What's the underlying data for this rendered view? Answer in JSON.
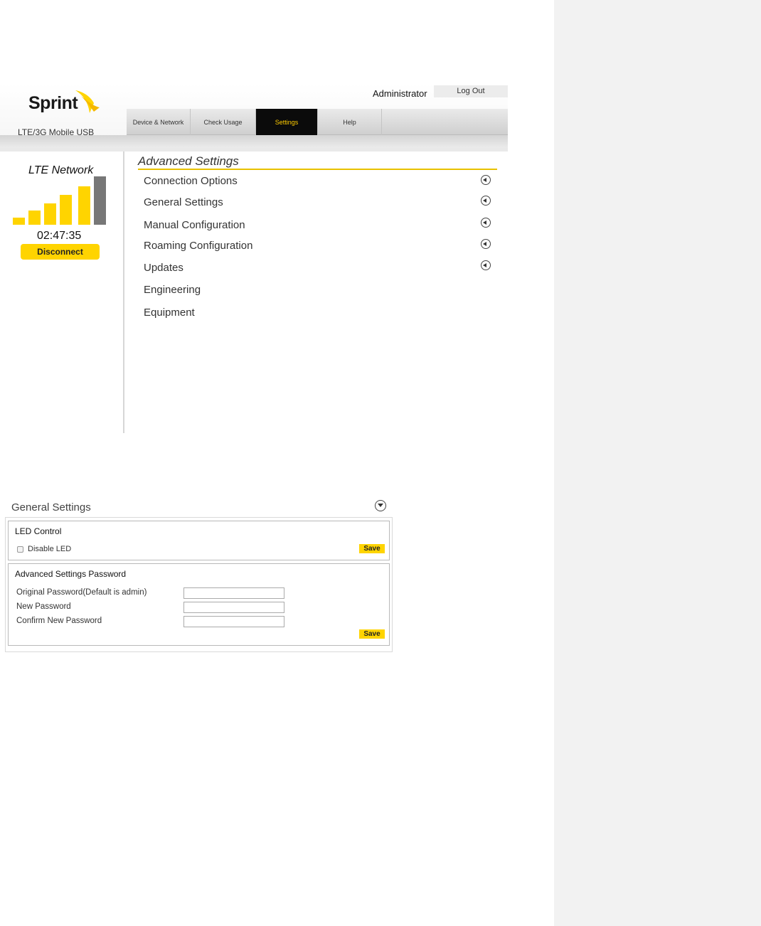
{
  "header": {
    "logo_text": "Sprint",
    "device_name": "LTE/3G Mobile USB",
    "user_label": "Administrator",
    "logout_label": "Log Out",
    "tabs": [
      {
        "label": "Device & Network",
        "active": false
      },
      {
        "label": "Check Usage",
        "active": false
      },
      {
        "label": "Settings",
        "active": true
      },
      {
        "label": "Help",
        "active": false
      }
    ]
  },
  "sidebar": {
    "network_label": "LTE Network",
    "signal": {
      "bars_filled": 5,
      "bars_total": 6
    },
    "timer": "02:47:35",
    "disconnect_label": "Disconnect"
  },
  "advanced": {
    "title": "Advanced Settings",
    "items": [
      {
        "label": "Connection Options",
        "icon": "expand-left-icon"
      },
      {
        "label": "General Settings",
        "icon": "expand-left-icon"
      },
      {
        "label": "Manual Configuration",
        "icon": "expand-left-icon"
      },
      {
        "label": "Roaming Configuration",
        "icon": "expand-left-icon"
      },
      {
        "label": "Updates",
        "icon": "expand-left-icon"
      },
      {
        "label": "Engineering"
      },
      {
        "label": "Equipment"
      }
    ]
  },
  "general_settings": {
    "title": "General Settings",
    "led_control": {
      "title": "LED Control",
      "checkbox_label": "Disable LED",
      "checked": false,
      "save_label": "Save"
    },
    "password": {
      "title": "Advanced Settings Password",
      "fields": [
        {
          "label": "Original Password(Default is admin)",
          "value": ""
        },
        {
          "label": "New Password",
          "value": ""
        },
        {
          "label": "Confirm New Password",
          "value": ""
        }
      ],
      "save_label": "Save"
    }
  },
  "colors": {
    "accent": "#ffd400",
    "active_tab_bg": "#0b0b0b",
    "active_tab_text": "#ffcc00",
    "underline": "#e8c100",
    "signal_empty": "#777777"
  }
}
